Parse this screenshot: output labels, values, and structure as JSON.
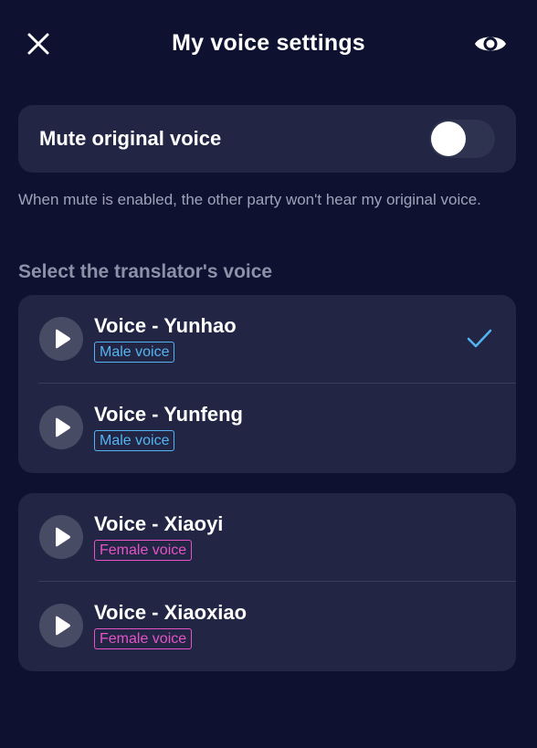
{
  "header": {
    "title": "My voice settings",
    "close_icon": "close-icon",
    "visibility_icon": "eye-icon"
  },
  "mute": {
    "label": "Mute original voice",
    "enabled": false,
    "hint": "When mute is enabled, the other party won't hear my original voice."
  },
  "voice_section": {
    "title": "Select the translator's voice"
  },
  "voices": [
    {
      "name": "Voice - Yunhao",
      "tag": "Male voice",
      "selected": true
    },
    {
      "name": "Voice - Yunfeng",
      "tag": "Male voice",
      "selected": false
    },
    {
      "name": "Voice - Xiaoyi",
      "tag": "Female voice",
      "selected": false
    },
    {
      "name": "Voice - Xiaoxiao",
      "tag": "Female voice",
      "selected": false
    }
  ],
  "colors": {
    "background": "#0e1130",
    "card": "#222644",
    "male_tag": "#54b4f2",
    "female_tag": "#e454c6",
    "check": "#54b4f2"
  }
}
